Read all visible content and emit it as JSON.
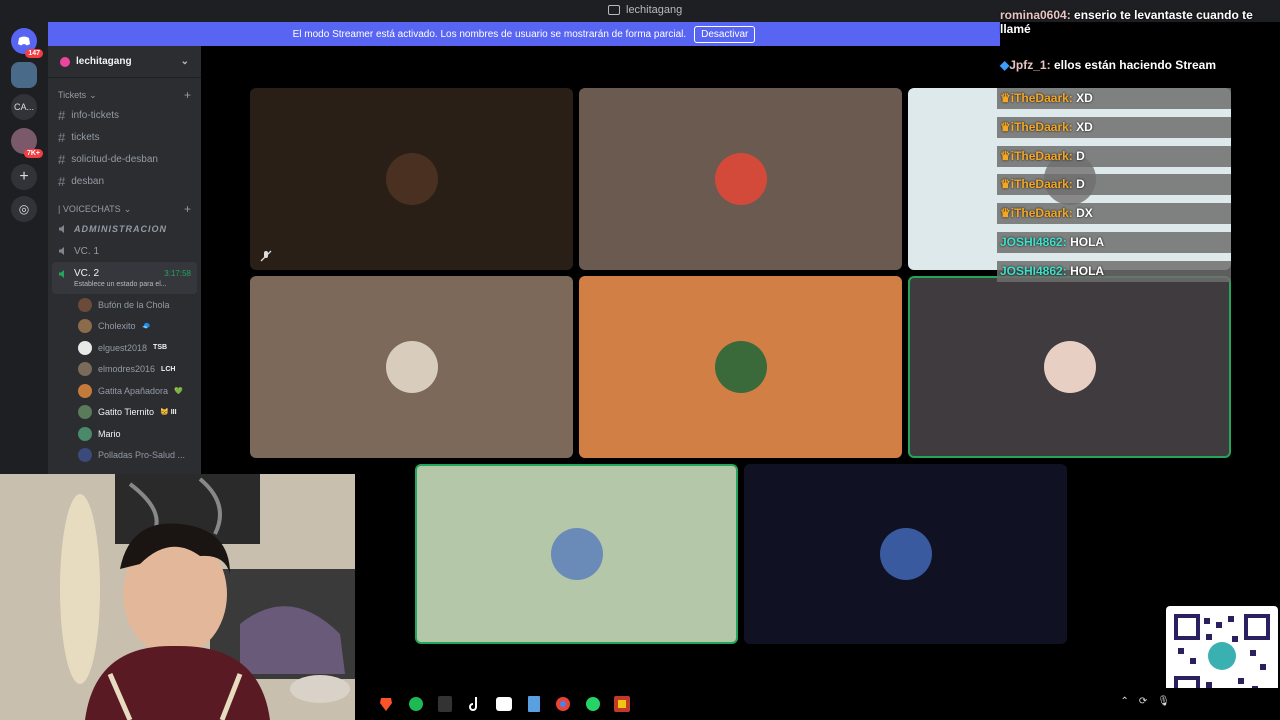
{
  "window": {
    "title": "lechitagang"
  },
  "banner": {
    "text": "El modo Streamer está activado. Los nombres de usuario se mostrarán de forma parcial.",
    "button": "Desactivar"
  },
  "rail": {
    "servers": [
      {
        "name": "discord-home",
        "badge": "147"
      },
      {
        "name": "server-lechitagang",
        "badge": ""
      },
      {
        "name": "server-ca",
        "label": "CA...",
        "badge": ""
      },
      {
        "name": "server-avatar",
        "badge": "7K+"
      }
    ]
  },
  "server": {
    "name": "lechitagang"
  },
  "sidebar": {
    "category_tickets": "Tickets",
    "text_channels": [
      "info-tickets",
      "tickets",
      "solicitud-de-desban",
      "desban"
    ],
    "category_voice": "| VOICECHATS",
    "voice_channels": [
      "ADMINISTRACION",
      "VC. 1"
    ],
    "active_channel": {
      "name": "VC. 2",
      "time": "3:17:58",
      "status": "Establece un estado para el..."
    },
    "users": [
      {
        "name": "Bufón de la Chola",
        "color": "#6b4a3a",
        "tag": ""
      },
      {
        "name": "Cholexito",
        "color": "#8b6b4a",
        "tag": "🧢"
      },
      {
        "name": "elguest2018",
        "color": "#e8e8e8",
        "tag": "TSB"
      },
      {
        "name": "elmodres2016",
        "color": "#7a6a5a",
        "tag": "LCH"
      },
      {
        "name": "Gatita Apañadora",
        "color": "#c47a3a",
        "tag": "💚"
      },
      {
        "name": "Gatito Tiernito",
        "color": "#5a7a5a",
        "tag": "😸 III"
      },
      {
        "name": "Mario",
        "color": "#4a8a6a",
        "tag": ""
      },
      {
        "name": "Polladas Pro-Salud ...",
        "color": "#3a4a7a",
        "tag": ""
      }
    ]
  },
  "tiles": [
    {
      "id": "tile-1",
      "bg": "#2a1f17",
      "avatar": "#4a3020",
      "speaking": false,
      "muted": true
    },
    {
      "id": "tile-2",
      "bg": "#6b5a50",
      "avatar": "#d44a3a",
      "speaking": false,
      "muted": false
    },
    {
      "id": "tile-3",
      "bg": "#dde9ea",
      "avatar": "#888",
      "speaking": false,
      "muted": false
    },
    {
      "id": "tile-4",
      "bg": "#7d6959",
      "avatar": "#d8ccbd",
      "speaking": false,
      "muted": false
    },
    {
      "id": "tile-5",
      "bg": "#d27f45",
      "avatar": "#3a6a3a",
      "speaking": false,
      "muted": false
    },
    {
      "id": "tile-6",
      "bg": "#3f3b3e",
      "avatar": "#e8cfc4",
      "speaking": true,
      "muted": false
    },
    {
      "id": "tile-7",
      "bg": "#b5c7a9",
      "avatar": "#6a8ab8",
      "speaking": true,
      "muted": false
    },
    {
      "id": "tile-8",
      "bg": "#101224",
      "avatar": "#3a5aa0",
      "speaking": false,
      "muted": false
    }
  ],
  "chat": [
    {
      "user": "romina0604",
      "text": "enserio te levantaste cuando te llamé",
      "style": "plain"
    },
    {
      "user": "Jpfz_1",
      "text": "ellos están haciendo Stream",
      "style": "cube"
    },
    {
      "user": "iTheDaark",
      "text": "XD",
      "style": "crown"
    },
    {
      "user": "iTheDaark",
      "text": "XD",
      "style": "crown"
    },
    {
      "user": "iTheDaark",
      "text": "D",
      "style": "crown"
    },
    {
      "user": "iTheDaark",
      "text": "D",
      "style": "crown"
    },
    {
      "user": "iTheDaark",
      "text": "DX",
      "style": "crown"
    },
    {
      "user": "JOSHI4862",
      "text": "HOLA",
      "style": "teal"
    },
    {
      "user": "JOSHI4862",
      "text": "HOLA",
      "style": "teal"
    }
  ],
  "colors": {
    "accent": "#5865f2",
    "speaking": "#23a55a",
    "rail": "#1e1f22",
    "sidebar": "#2b2d31"
  },
  "taskbar": {
    "apps": [
      "brave-icon",
      "spotify-icon",
      "epic-icon",
      "tiktok-icon",
      "capcut-icon",
      "calculator-icon",
      "chrome-icon",
      "whatsapp-icon",
      "game-icon"
    ]
  }
}
